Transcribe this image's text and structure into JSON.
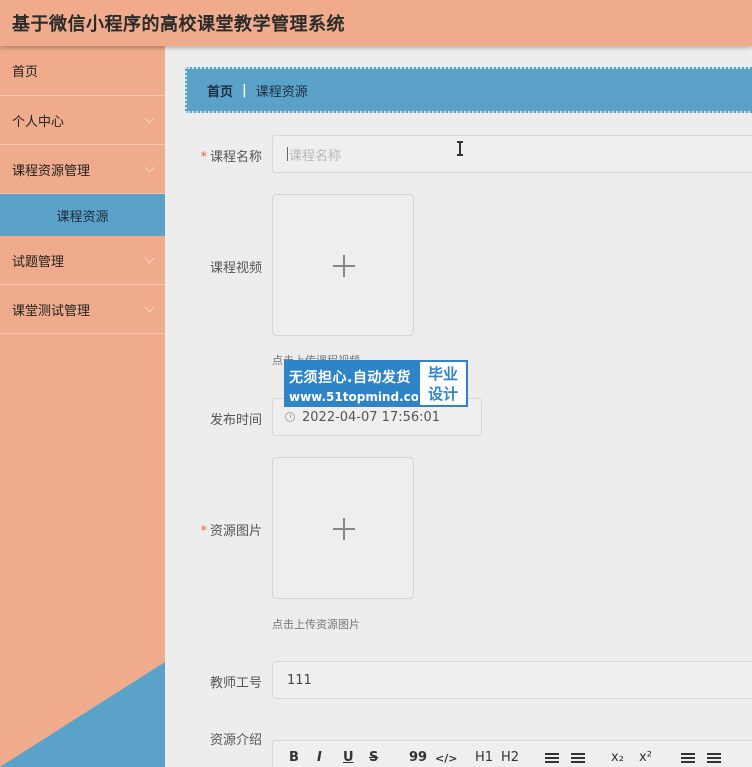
{
  "app": {
    "title": "基于微信小程序的高校课堂教学管理系统"
  },
  "sidebar": {
    "items": [
      {
        "label": "首页",
        "expandable": false
      },
      {
        "label": "个人中心",
        "expandable": true
      },
      {
        "label": "课程资源管理",
        "expandable": true
      },
      {
        "label": "课程资源",
        "sub": true,
        "active": true
      },
      {
        "label": "试题管理",
        "expandable": true
      },
      {
        "label": "课堂测试管理",
        "expandable": true
      }
    ]
  },
  "breadcrumb": {
    "home": "首页",
    "separator": "|",
    "current": "课程资源"
  },
  "form": {
    "course_name": {
      "label": "课程名称",
      "required": true,
      "value": "",
      "placeholder": "课程名称"
    },
    "course_video": {
      "label": "课程视频",
      "hint": "点击上传课程视频"
    },
    "publish_time": {
      "label": "发布时间",
      "value": "2022-04-07 17:56:01"
    },
    "resource_image": {
      "label": "资源图片",
      "required": true,
      "hint": "点击上传资源图片"
    },
    "teacher_id": {
      "label": "教师工号",
      "value": "111"
    },
    "resource_intro": {
      "label": "资源介绍"
    }
  },
  "editor_toolbar": {
    "bold": "B",
    "italic": "I",
    "underline": "U",
    "strike": "S",
    "quote": "99",
    "code": "</>",
    "h1": "H1",
    "h2": "H2",
    "subscript": "x₂",
    "superscript": "x²"
  },
  "watermark": {
    "line1": "无须担心.自动发货",
    "line2": "www.51topmind.com",
    "badge1": "毕业",
    "badge2": "设计"
  },
  "colors": {
    "header": "#efab8b",
    "sidebar": "#efab8b",
    "accent": "#5ba2c9",
    "required": "#e8674a"
  }
}
